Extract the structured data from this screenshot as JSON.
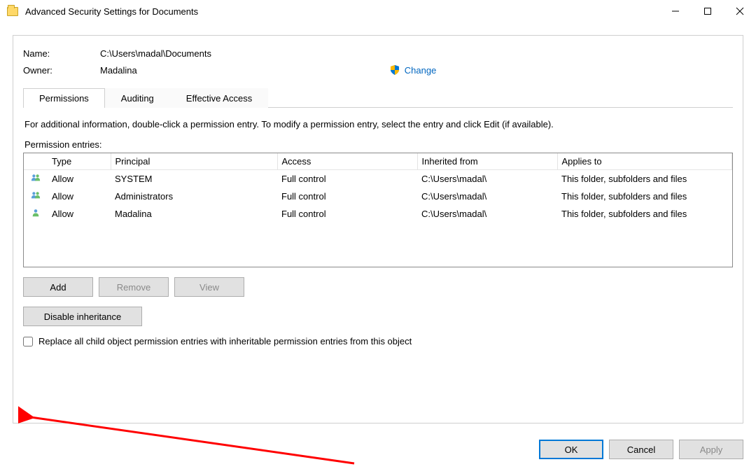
{
  "window": {
    "title": "Advanced Security Settings for Documents"
  },
  "header": {
    "name_label": "Name:",
    "name_value": "C:\\Users\\madal\\Documents",
    "owner_label": "Owner:",
    "owner_value": "Madalina",
    "change_link": "Change"
  },
  "tabs": [
    {
      "label": "Permissions",
      "active": true
    },
    {
      "label": "Auditing",
      "active": false
    },
    {
      "label": "Effective Access",
      "active": false
    }
  ],
  "instructions": "For additional information, double-click a permission entry. To modify a permission entry, select the entry and click Edit (if available).",
  "permission_section_label": "Permission entries:",
  "columns": {
    "type": "Type",
    "principal": "Principal",
    "access": "Access",
    "inherited": "Inherited from",
    "applies": "Applies to"
  },
  "entries": [
    {
      "icon": "group",
      "type": "Allow",
      "principal": "SYSTEM",
      "access": "Full control",
      "inherited": "C:\\Users\\madal\\",
      "applies": "This folder, subfolders and files"
    },
    {
      "icon": "group",
      "type": "Allow",
      "principal": "Administrators",
      "access": "Full control",
      "inherited": "C:\\Users\\madal\\",
      "applies": "This folder, subfolders and files"
    },
    {
      "icon": "user",
      "type": "Allow",
      "principal": "Madalina",
      "access": "Full control",
      "inherited": "C:\\Users\\madal\\",
      "applies": "This folder, subfolders and files"
    }
  ],
  "buttons": {
    "add": "Add",
    "remove": "Remove",
    "view": "View",
    "disable_inheritance": "Disable inheritance",
    "ok": "OK",
    "cancel": "Cancel",
    "apply": "Apply"
  },
  "checkbox": {
    "label": "Replace all child object permission entries with inheritable permission entries from this object",
    "checked": false
  }
}
